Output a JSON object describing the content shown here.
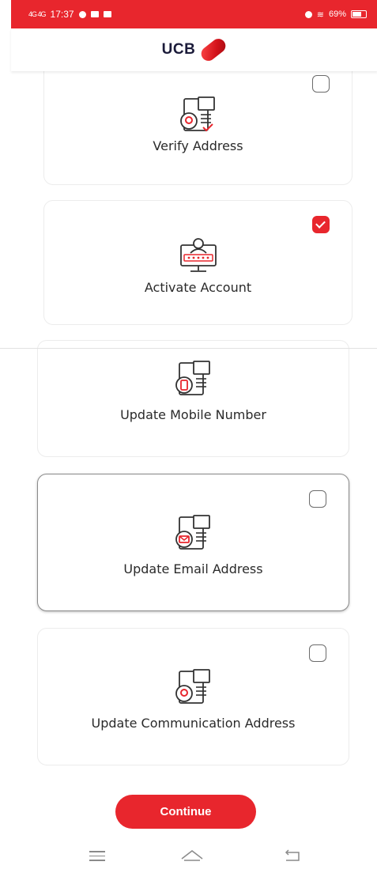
{
  "status_bar": {
    "signal": "4G 4G",
    "time": "17:37",
    "battery": "69%"
  },
  "brand": {
    "name": "UCB"
  },
  "accent_color": "#e8262d",
  "services": [
    {
      "label": "Verify Address",
      "checked": false,
      "icon": "document-location-check-icon"
    },
    {
      "label": "Activate Account",
      "checked": true,
      "icon": "monitor-user-password-icon"
    },
    {
      "label": "Update Mobile Number",
      "checked": false,
      "icon": "document-mobile-icon"
    },
    {
      "label": "Update Email Address",
      "checked": false,
      "icon": "document-email-icon"
    },
    {
      "label": "Update Communication Address",
      "checked": false,
      "icon": "document-location-icon"
    }
  ],
  "continue_label": "Continue"
}
